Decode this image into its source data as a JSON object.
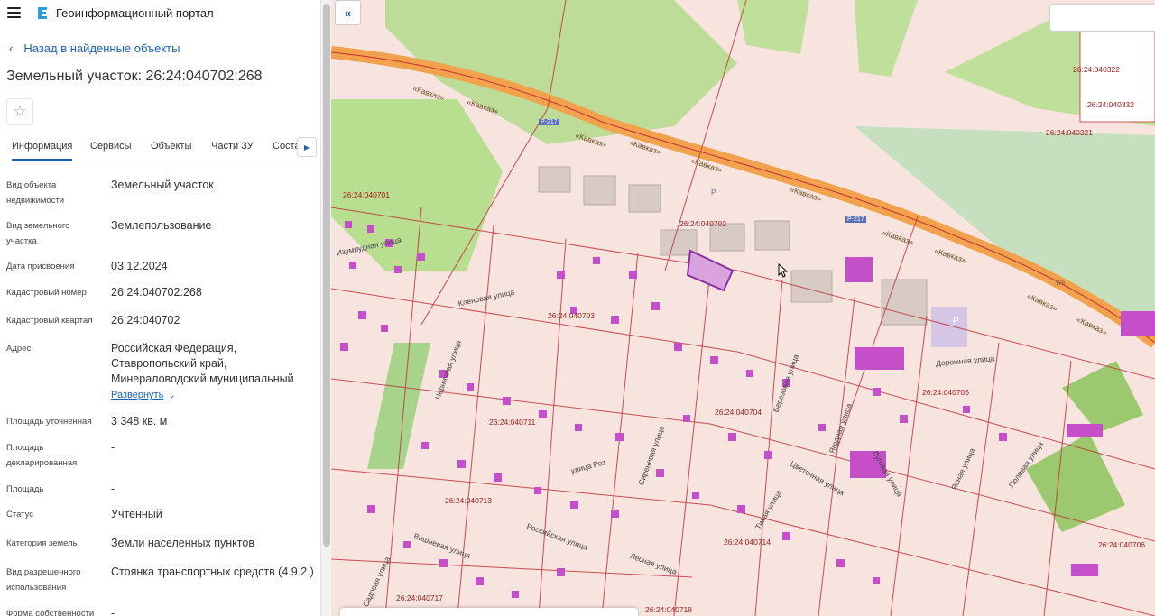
{
  "app": {
    "title": "Геоинформационный портал"
  },
  "nav": {
    "back_label": "Назад в найденные объекты"
  },
  "object": {
    "title": "Земельный участок: 26:24:040702:268"
  },
  "tabs": [
    {
      "label": "Информация",
      "active": true
    },
    {
      "label": "Сервисы"
    },
    {
      "label": "Объекты"
    },
    {
      "label": "Части ЗУ"
    },
    {
      "label": "Соста"
    }
  ],
  "attributes": [
    {
      "label": "Вид объекта недвижимости",
      "value": "Земельный участок"
    },
    {
      "label": "Вид земельного участка",
      "value": "Землепользование"
    },
    {
      "label": "Дата присвоения",
      "value": "03.12.2024"
    },
    {
      "label": "Кадастровый номер",
      "value": "26:24:040702:268"
    },
    {
      "label": "Кадастровый квартал",
      "value": "26:24:040702"
    },
    {
      "label": "Адрес",
      "value": "Российская Федерация, Ставропольский край, Минераловодский муниципальный"
    },
    {
      "label": "Площадь уточненная",
      "value": "3 348 кв. м"
    },
    {
      "label": "Площадь декларированная",
      "value": "-"
    },
    {
      "label": "Площадь",
      "value": "-"
    },
    {
      "label": "Статус",
      "value": "Учтенный"
    },
    {
      "label": "Категория земель",
      "value": "Земли населенных пунктов"
    },
    {
      "label": "Вид разрешенного использования",
      "value": "Стоянка транспортных средств (4.9.2.)"
    },
    {
      "label": "Форма собственности",
      "value": "-"
    }
  ],
  "address_expand_label": "Развернуть",
  "map": {
    "quarter_labels": [
      "26:24:040701",
      "26:24:040702",
      "26:24:040703",
      "26:24:040704",
      "26:24:040705",
      "26:24:040711",
      "26:24:040713",
      "26:24:040714",
      "26:24:040717",
      "26:24:040718",
      "26:24:040706",
      "26:24:040321",
      "26:24:040322",
      "26:24:040332"
    ],
    "road_labels": [
      "«Кавказ»",
      "«Кавказ»",
      "«Кавказ»",
      "«Кавказ»",
      "«Кавказ»",
      "«Кавказ»",
      "«Кавказ»",
      "«Кавказ»",
      "«Кавказ»",
      "«Кавказ»"
    ],
    "route_labels": [
      "Р-217",
      "Р-217"
    ],
    "street_labels": [
      "Изумрудная улица",
      "Черничная улица",
      "Березовая улица",
      "Дорожная улица",
      "улица Роз",
      "Российская улица",
      "Вишневая улица",
      "Ясная улица",
      "Луговая улица",
      "Цветочная улица",
      "Сиреневая улица",
      "Ягодная улица",
      "Тихая улица",
      "Полевая улица",
      "Кленовая улица",
      "Лесная улица",
      "Садовая улица"
    ],
    "misc_labels": [
      "Р",
      "P",
      "178"
    ],
    "colors": {
      "land": "#f7e4de",
      "road": "#f2a14c",
      "parcel_line": "#c0313a",
      "building": "#c54fc8",
      "green": "#bfe09a",
      "highlight": "#8b2fa3"
    }
  }
}
